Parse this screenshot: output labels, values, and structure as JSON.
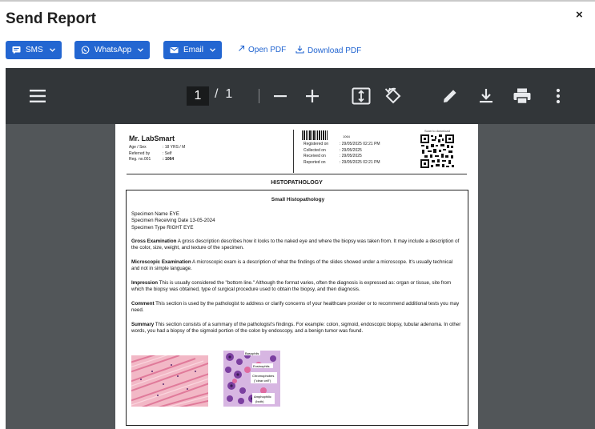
{
  "dialog": {
    "title": "Send Report",
    "close_label": "×"
  },
  "share": {
    "sms_label": "SMS",
    "whatsapp_label": "WhatsApp",
    "email_label": "Email",
    "open_pdf_label": "Open PDF",
    "download_pdf_label": "Download PDF"
  },
  "viewer": {
    "current_page": "1",
    "separator": "/",
    "total_pages": "1"
  },
  "report": {
    "patient_name": "Mr. LabSmart",
    "age_sex_label": "Age / Sex",
    "age_sex_value": ": 18 YRS / M",
    "referred_by_label": "Referred by",
    "referred_by_value": ": Self",
    "reg_no_label": "Reg. no.001",
    "reg_no_value": ": 1064",
    "barcode_number": "1064",
    "registered_label": "Registered on",
    "registered_value": ": 29/05/2025 02:21 PM",
    "collected_label": "Collected on",
    "collected_value": ": 29/05/2025",
    "received_label": "Received on",
    "received_value": ": 29/05/2025",
    "reported_label": "Reported on",
    "reported_value": ": 29/05/2025 02:21 PM",
    "qr_caption": "Scan to download",
    "department": "HISTOPATHOLOGY",
    "test_title": "Small Histopathology",
    "specimen_name": "Specimen Name EYE",
    "specimen_date": "Specimen Receiving Date 13-05-2024",
    "specimen_type": "Specimen Type RIGHT EYE",
    "gross_heading": "Gross Examination",
    "gross_text": " A gross description describes how it looks to the naked eye and where the biopsy was taken from. It may include a description of the color, size, weight, and texture of the specimen.",
    "micro_heading": "Microscopic Examination",
    "micro_text": " A microscopic exam is a description of what the findings of the slides showed under a microscope. It's usually technical and not in simple language.",
    "impression_heading": "Impression",
    "impression_text": " This is usually considered the \"bottom line.\" Although the format varies, often the diagnosis is expressed as: organ or tissue, site from which the biopsy was obtained, type of surgical procedure used to obtain the biopsy, and then diagnosis.",
    "comment_heading": "Comment",
    "comment_text": " This section is used by the pathologist to address or clarify concerns of your healthcare provider or to recommend additional tests you may need.",
    "summary_heading": "Summary",
    "summary_text": " This section consists of a summary of the pathologist's findings. For example: colon, sigmoid, endoscopic biopsy, tubular adenoma. In other words, you had a biopsy of the sigmoid portion of the colon by endoscopy, and a benign tumor was found.",
    "image2_labels": {
      "basophils": "Basophils",
      "eosinophils": "Eosinophils",
      "chromophobe": "Chromophobes",
      "chromophobe2": "(\"clear cell\")",
      "amphophils": "Amphophilic",
      "amphophils2": "(both)"
    }
  },
  "colors": {
    "accent": "#2366d1",
    "viewer_bg": "#525659",
    "toolbar_bg": "#323639"
  }
}
